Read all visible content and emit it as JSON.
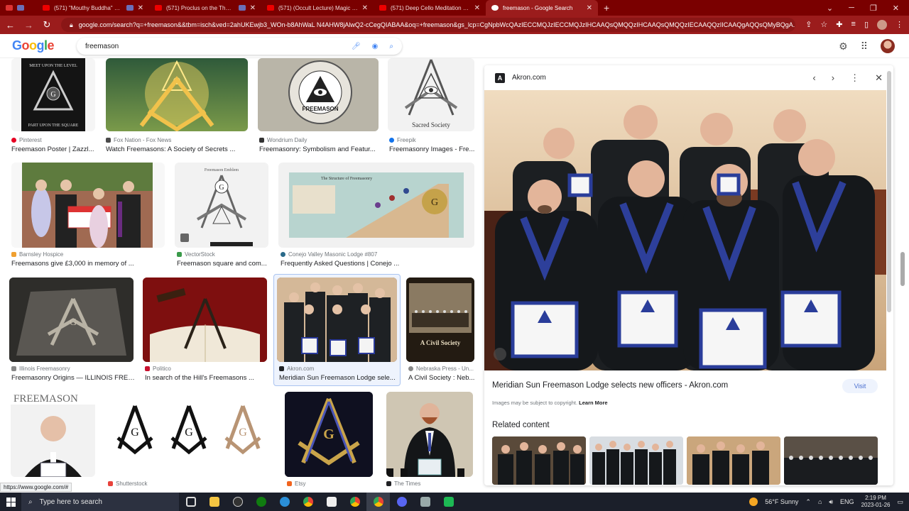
{
  "browser": {
    "tabs": [
      {
        "label": "",
        "icon": "app-icon"
      },
      {
        "label": "(571) \"Mouthy Buddha\" Cre",
        "icon": "youtube-icon"
      },
      {
        "label": "(571) Proclus on the Theolo",
        "icon": "youtube-icon"
      },
      {
        "label": "(571) (Occult Lecture) Magic & t",
        "icon": "youtube-icon"
      },
      {
        "label": "(571) Deep Cello Meditation Mu",
        "icon": "youtube-icon"
      },
      {
        "label": "freemason - Google Search",
        "icon": "google-icon",
        "active": true
      }
    ],
    "url": "google.com/search?q=+freemason&&tbm=isch&ved=2ahUKEwjb3_WOn-b8AhWaL N4AHW8jAlwQ2-cCegQIABAA&oq=+freemason&gs_lcp=CgNpbWcQAzIECCMQJzIECCMQJzIHCAAQsQMQQzIHCAAQsQMQQzIECAAQQzIICAAQgAQQsQMyBQgA...",
    "status_url": "https://www.google.com/#"
  },
  "search": {
    "logo": "Google",
    "query": "freemason"
  },
  "results": [
    {
      "source": "Pinterest",
      "title": "Freemason Poster | Zazzl...",
      "src_color": "#e60023"
    },
    {
      "source": "Fox Nation - Fox News",
      "title": "Watch Freemasons: A Society of Secrets ...",
      "src_color": "#4a4a4a"
    },
    {
      "source": "Wondrium Daily",
      "title": "Freemasonry: Symbolism and Featur...",
      "src_color": "#333333"
    },
    {
      "source": "Freepik",
      "title": "Freemasonry Images - Fre...",
      "src_color": "#1273eb"
    },
    {
      "source": "Barnsley Hospice",
      "title": "Freemasons give £3,000 in memory of ...",
      "src_color": "#f0a030"
    },
    {
      "source": "VectorStock",
      "title": "Freemason square and com...",
      "src_color": "#3a9a4a"
    },
    {
      "source": "Conejo Valley Masonic Lodge #807",
      "title": "Frequently Asked Questions | Conejo ...",
      "src_color": "#2a6a8a"
    },
    {
      "source": "Illinois Freemasonry",
      "title": "Freemasonry Origins — ILLINOIS FREE...",
      "src_color": "#888888"
    },
    {
      "source": "Politico",
      "title": "In search of the Hill's Freemasons ...",
      "src_color": "#c8102e"
    },
    {
      "source": "Akron.com",
      "title": "Meridian Sun Freemason Lodge sele...",
      "src_color": "#202124"
    },
    {
      "source": "Nebraska Press - Un...",
      "title": "A Civil Society : Neb...",
      "src_color": "#888888"
    },
    {
      "source": "Shutterstock",
      "title": "",
      "src_color": "#e8423b"
    },
    {
      "source": "Etsy",
      "title": "",
      "src_color": "#f1641e"
    },
    {
      "source": "The Times",
      "title": "",
      "src_color": "#202124"
    }
  ],
  "thumb_text": {
    "poster_top": "MEET UPON THE LEVEL",
    "poster_bottom": "PART UPON THE SQUARE",
    "freemason_coin": "FREEMASON",
    "sacred": "Sacred Society",
    "emblem": "Freemason Emblem",
    "structure": "The Structure of Freemasonry",
    "civil": "A Civil Society",
    "book_title": "FREEMASON"
  },
  "panel": {
    "site": "Akron.com",
    "title": "Meridian Sun Freemason Lodge selects new officers - Akron.com",
    "visit": "Visit",
    "copyright": "Images may be subject to copyright.",
    "learn_more": "Learn More",
    "related": "Related content"
  },
  "taskbar": {
    "search_placeholder": "Type here to search",
    "weather": "56°F  Sunny",
    "lang": "ENG",
    "time": "2:19 PM",
    "date": "2023-01-26"
  }
}
